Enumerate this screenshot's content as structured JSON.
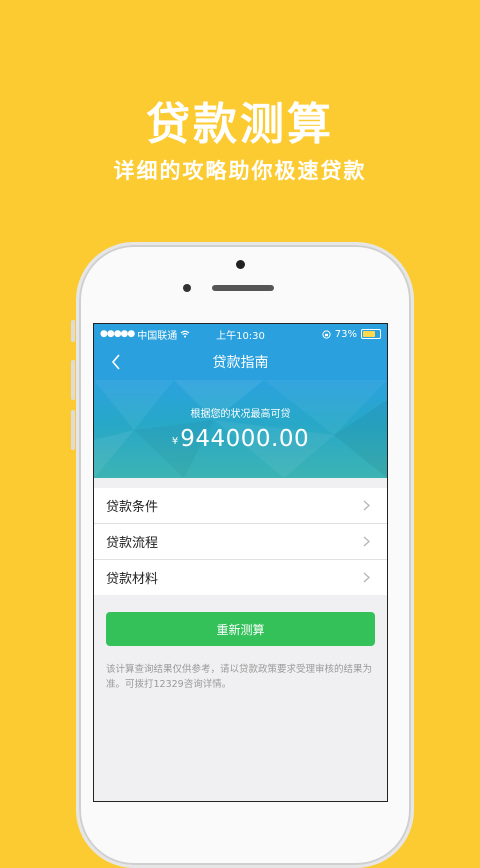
{
  "promo": {
    "title": "贷款测算",
    "subtitle": "详细的攻略助你极速贷款"
  },
  "status_bar": {
    "carrier": "中国联通",
    "time": "上午10:30",
    "battery": "73%",
    "battery_level": 0.73
  },
  "nav": {
    "title": "贷款指南"
  },
  "hero": {
    "caption": "根据您的状况最高可贷",
    "currency": "¥",
    "amount": "944000.00"
  },
  "menu": {
    "items": [
      {
        "label": "贷款条件"
      },
      {
        "label": "贷款流程"
      },
      {
        "label": "贷款材料"
      }
    ]
  },
  "actions": {
    "recalc_label": "重新测算"
  },
  "disclaimer": "该计算查询结果仅供参考，请以贷款政策要求受理审核的结果为准。可拨打12329咨询详情。",
  "colors": {
    "background": "#fccb31",
    "header": "#2aa1de",
    "primary_button": "#34c15a"
  }
}
